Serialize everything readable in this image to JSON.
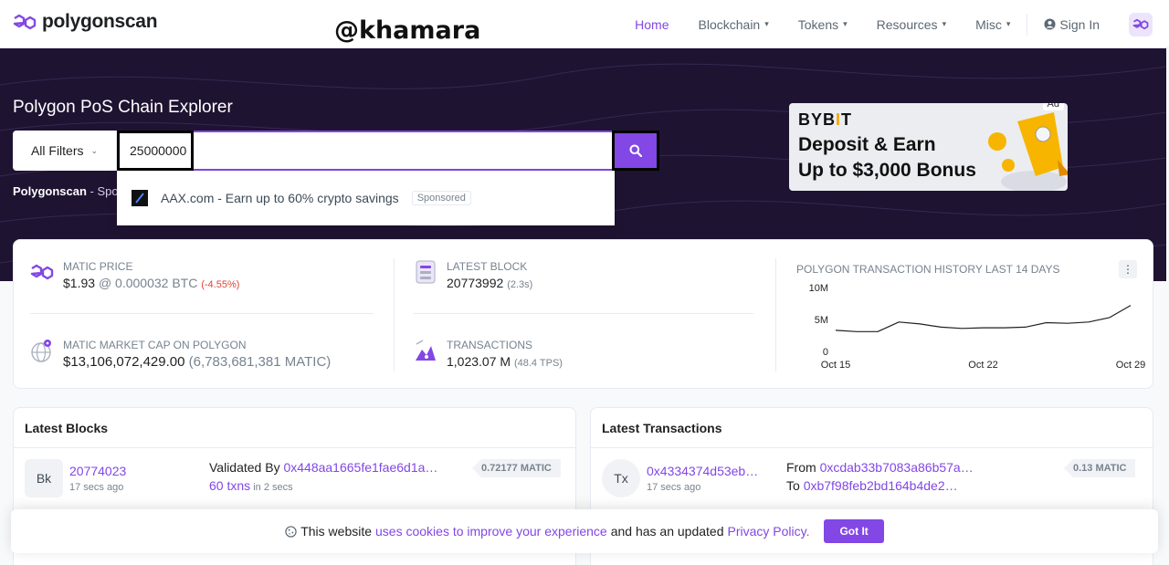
{
  "brand": {
    "name": "polygonscan"
  },
  "watermark": "@khamara",
  "nav": {
    "home": "Home",
    "blockchain": "Blockchain",
    "tokens": "Tokens",
    "resources": "Resources",
    "misc": "Misc",
    "sign_in": "Sign In"
  },
  "hero": {
    "title": "Polygon PoS Chain Explorer",
    "filter_label": "All Filters",
    "search_value": "25000000",
    "sub_brand": "Polygonscan",
    "sub_text": " - Spo"
  },
  "dropdown": {
    "text": "AAX.com - Earn up to 60% crypto savings",
    "badge": "Sponsored"
  },
  "ad": {
    "tag": "Ad",
    "brand_a": "BYB",
    "brand_b": "I",
    "brand_c": "T",
    "line1": "Deposit & Earn",
    "line2": "Up to $3,000 Bonus"
  },
  "stats": {
    "price_label": "MATIC Price",
    "price_value": "$1.93",
    "price_btc": "@ 0.000032 BTC",
    "price_change": "(-4.55%)",
    "mcap_label": "MATIC Market Cap on Polygon",
    "mcap_value": "$13,106,072,429.00",
    "mcap_matic": "(6,783,681,381 MATIC)",
    "block_label": "Latest Block",
    "block_value": "20773992",
    "block_time": "(2.3s)",
    "tx_label": "Transactions",
    "tx_value": "1,023.07 M",
    "tx_tps": "(48.4 TPS)"
  },
  "chart_data": {
    "type": "line",
    "title": "Polygon Transaction History Last 14 Days",
    "x": [
      "Oct 15",
      "Oct 16",
      "Oct 17",
      "Oct 18",
      "Oct 19",
      "Oct 20",
      "Oct 21",
      "Oct 22",
      "Oct 23",
      "Oct 24",
      "Oct 25",
      "Oct 26",
      "Oct 27",
      "Oct 28",
      "Oct 29"
    ],
    "x_tick_labels": [
      "Oct 15",
      "Oct 22",
      "Oct 29"
    ],
    "values": [
      3300000,
      3100000,
      3100000,
      4600000,
      4300000,
      3800000,
      3600000,
      3700000,
      3700000,
      3800000,
      4500000,
      4400000,
      4600000,
      5300000,
      7200000
    ],
    "y_tick_labels": [
      "10M",
      "5M",
      "0"
    ],
    "ylim": [
      0,
      10000000
    ]
  },
  "blocks": {
    "title": "Latest Blocks",
    "rows": [
      {
        "badge": "Bk",
        "number": "20774023",
        "age": "17 secs ago",
        "validated_label": "Validated By ",
        "validator": "0x448aa1665fe1fae6d1a…",
        "txns": "60 txns",
        "txns_time": " in 2 secs",
        "reward": "0.72177 MATIC"
      }
    ]
  },
  "txns": {
    "title": "Latest Transactions",
    "rows": [
      {
        "badge": "Tx",
        "hash": "0x4334374d53eb…",
        "age": "17 secs ago",
        "from_label": "From ",
        "from": "0xcdab33b7083a86b57a…",
        "to_label": "To ",
        "to": "0xb7f98feb2bd164b4de2…",
        "amount": "0.13 MATIC"
      }
    ]
  },
  "cookie": {
    "text1": "This website ",
    "link1": "uses cookies to improve your experience",
    "text2": " and has an updated ",
    "link2": "Privacy Policy.",
    "button": "Got It"
  },
  "colors": {
    "accent": "#8247e5",
    "hero_bg": "#1f1332",
    "negative": "#de4437"
  }
}
